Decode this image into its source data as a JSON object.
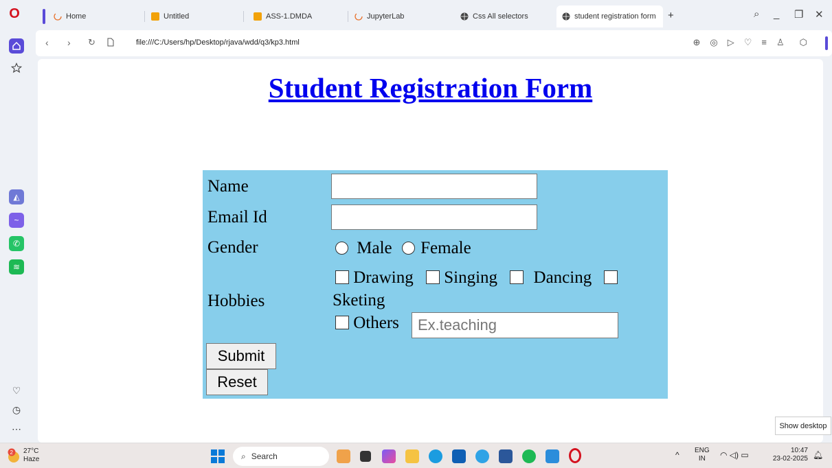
{
  "tabs": [
    {
      "label": "Home"
    },
    {
      "label": "Untitled"
    },
    {
      "label": "ASS-1.DMDA"
    },
    {
      "label": "JupyterLab"
    },
    {
      "label": "Css All selectors"
    },
    {
      "label": "student registration form"
    }
  ],
  "address": {
    "url": "file:///C:/Users/hp/Desktop/rjava/wdd/q3/kp3.html"
  },
  "form": {
    "title": "Student Registration Form",
    "name_label": "Name",
    "email_label": "Email Id",
    "gender_label": "Gender",
    "gender_options": [
      "Male",
      "Female"
    ],
    "hobbies_label": "Hobbies",
    "hobbies": [
      "Drawing",
      "Singing",
      "Dancing",
      "Sketing",
      "Others"
    ],
    "others_placeholder": "Ex.teaching",
    "submit_label": "Submit",
    "reset_label": "Reset"
  },
  "tooltip": {
    "show_desktop": "Show desktop"
  },
  "taskbar": {
    "temperature": "27°C",
    "weather": "Haze",
    "search_placeholder": "Search",
    "lang_top": "ENG",
    "lang_bottom": "IN",
    "time": "10:47",
    "date": "23-02-2025",
    "notification_count": "2"
  },
  "colors": {
    "form_bg": "#87ceeb",
    "title": "#0000ee",
    "opera_accent": "#5a4bd8"
  }
}
